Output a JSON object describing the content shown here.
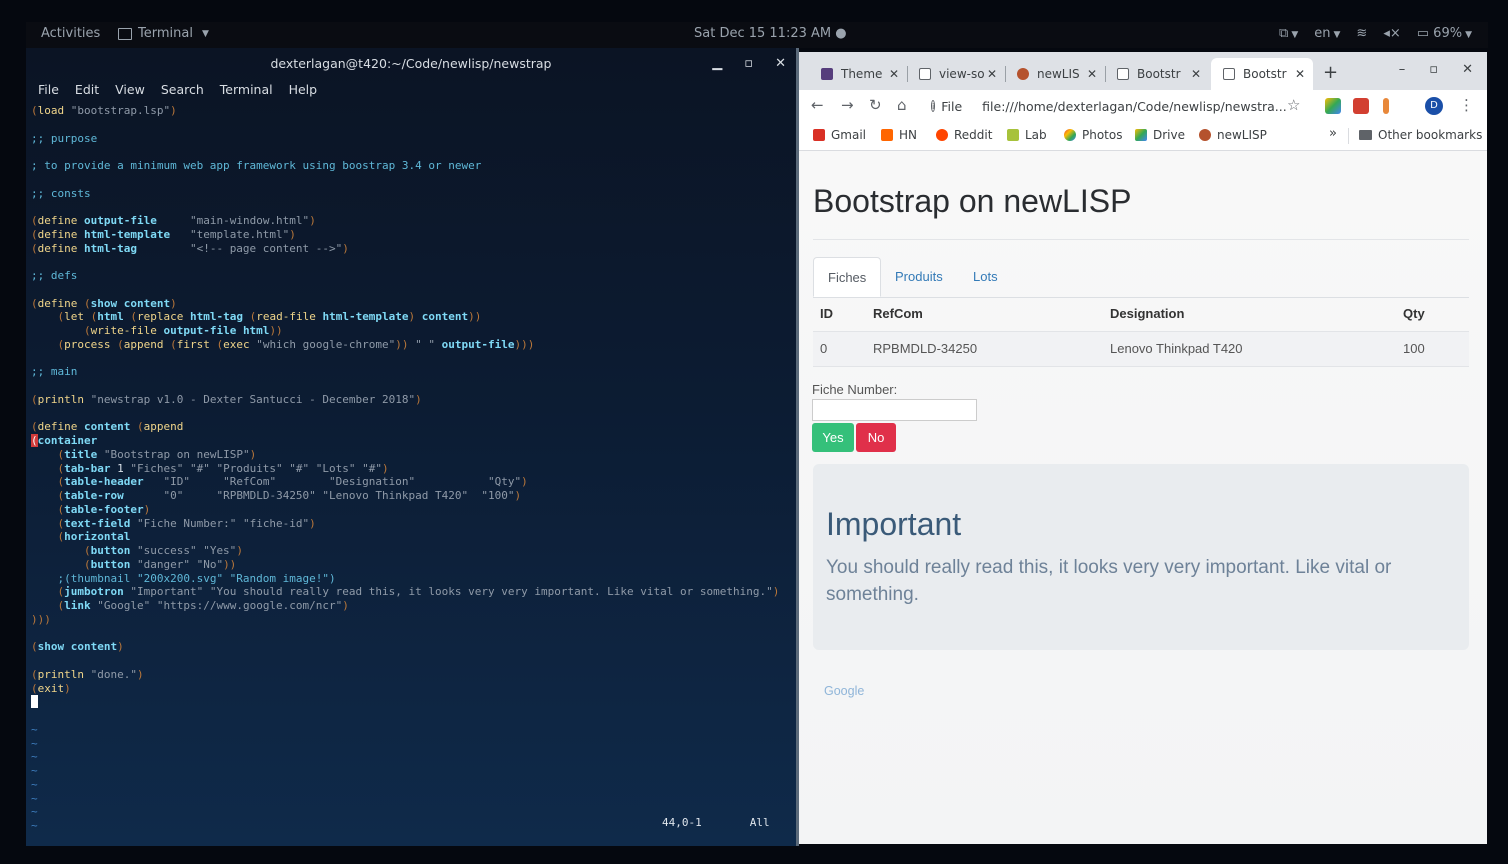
{
  "topbar": {
    "activities": "Activities",
    "app_menu": "Terminal",
    "clock": "Sat Dec 15  11:23 AM",
    "lang": "en",
    "battery": "69%"
  },
  "terminal": {
    "title": "dexterlagan@t420:~/Code/newlisp/newstrap",
    "menu": [
      "File",
      "Edit",
      "View",
      "Search",
      "Terminal",
      "Help"
    ],
    "status_pos": "44,0-1",
    "status_all": "All"
  },
  "chrome": {
    "tabs": [
      "Theme",
      "view-so",
      "newLIS",
      "Bootstr",
      "Bootstr"
    ],
    "omnibox_scheme": "File",
    "omnibox_url": "file:///home/dexterlagan/Code/newlisp/newstra...",
    "avatar_letter": "D",
    "bookmarks": [
      "Gmail",
      "HN",
      "Reddit",
      "Lab",
      "Photos",
      "Drive",
      "newLISP"
    ],
    "bookmarks_more": "»",
    "other_bookmarks": "Other bookmarks"
  },
  "page": {
    "title": "Bootstrap on newLISP",
    "tabs": [
      "Fiches",
      "Produits",
      "Lots"
    ],
    "table_headers": [
      "ID",
      "RefCom",
      "Designation",
      "Qty"
    ],
    "table_rows": [
      [
        "0",
        "RPBMDLD-34250",
        "Lenovo Thinkpad T420",
        "100"
      ]
    ],
    "form_label": "Fiche Number:",
    "btn_yes": "Yes",
    "btn_no": "No",
    "jumbo_title": "Important",
    "jumbo_text": "You should really read this, it looks very very important. Like vital or something.",
    "link": "Google"
  },
  "colors": {
    "success": "#35c07a",
    "danger": "#e0304a",
    "link": "#337ab7"
  }
}
